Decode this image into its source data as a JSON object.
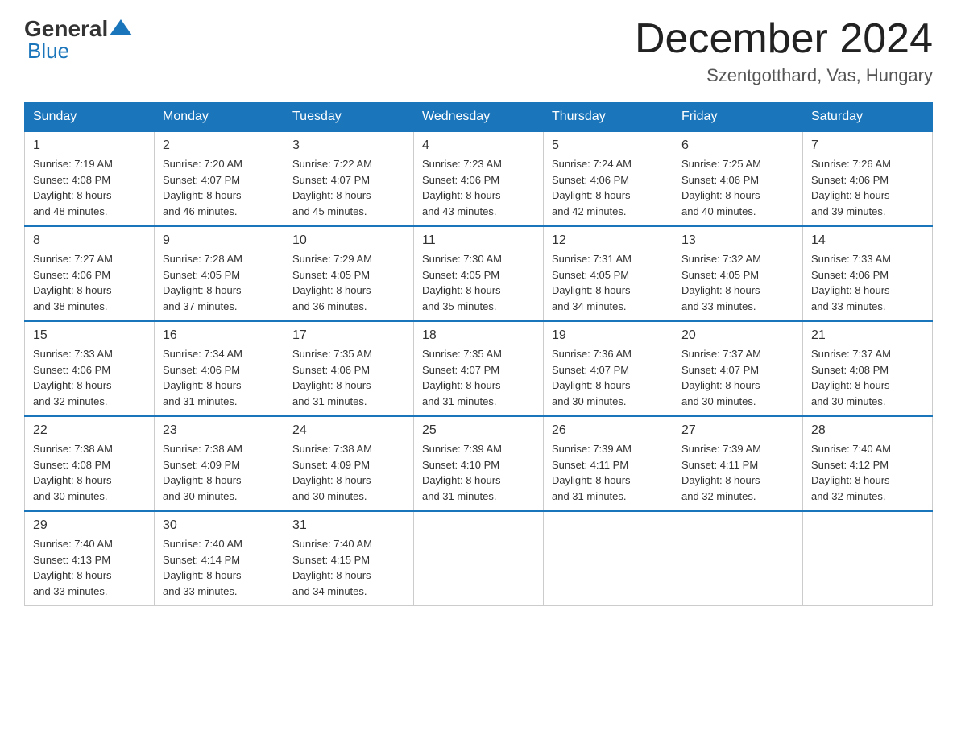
{
  "header": {
    "logo": {
      "general": "General",
      "blue": "Blue"
    },
    "title": "December 2024",
    "location": "Szentgotthard, Vas, Hungary"
  },
  "weekdays": [
    "Sunday",
    "Monday",
    "Tuesday",
    "Wednesday",
    "Thursday",
    "Friday",
    "Saturday"
  ],
  "weeks": [
    [
      {
        "day": "1",
        "sunrise": "7:19 AM",
        "sunset": "4:08 PM",
        "daylight": "8 hours and 48 minutes."
      },
      {
        "day": "2",
        "sunrise": "7:20 AM",
        "sunset": "4:07 PM",
        "daylight": "8 hours and 46 minutes."
      },
      {
        "day": "3",
        "sunrise": "7:22 AM",
        "sunset": "4:07 PM",
        "daylight": "8 hours and 45 minutes."
      },
      {
        "day": "4",
        "sunrise": "7:23 AM",
        "sunset": "4:06 PM",
        "daylight": "8 hours and 43 minutes."
      },
      {
        "day": "5",
        "sunrise": "7:24 AM",
        "sunset": "4:06 PM",
        "daylight": "8 hours and 42 minutes."
      },
      {
        "day": "6",
        "sunrise": "7:25 AM",
        "sunset": "4:06 PM",
        "daylight": "8 hours and 40 minutes."
      },
      {
        "day": "7",
        "sunrise": "7:26 AM",
        "sunset": "4:06 PM",
        "daylight": "8 hours and 39 minutes."
      }
    ],
    [
      {
        "day": "8",
        "sunrise": "7:27 AM",
        "sunset": "4:06 PM",
        "daylight": "8 hours and 38 minutes."
      },
      {
        "day": "9",
        "sunrise": "7:28 AM",
        "sunset": "4:05 PM",
        "daylight": "8 hours and 37 minutes."
      },
      {
        "day": "10",
        "sunrise": "7:29 AM",
        "sunset": "4:05 PM",
        "daylight": "8 hours and 36 minutes."
      },
      {
        "day": "11",
        "sunrise": "7:30 AM",
        "sunset": "4:05 PM",
        "daylight": "8 hours and 35 minutes."
      },
      {
        "day": "12",
        "sunrise": "7:31 AM",
        "sunset": "4:05 PM",
        "daylight": "8 hours and 34 minutes."
      },
      {
        "day": "13",
        "sunrise": "7:32 AM",
        "sunset": "4:05 PM",
        "daylight": "8 hours and 33 minutes."
      },
      {
        "day": "14",
        "sunrise": "7:33 AM",
        "sunset": "4:06 PM",
        "daylight": "8 hours and 33 minutes."
      }
    ],
    [
      {
        "day": "15",
        "sunrise": "7:33 AM",
        "sunset": "4:06 PM",
        "daylight": "8 hours and 32 minutes."
      },
      {
        "day": "16",
        "sunrise": "7:34 AM",
        "sunset": "4:06 PM",
        "daylight": "8 hours and 31 minutes."
      },
      {
        "day": "17",
        "sunrise": "7:35 AM",
        "sunset": "4:06 PM",
        "daylight": "8 hours and 31 minutes."
      },
      {
        "day": "18",
        "sunrise": "7:35 AM",
        "sunset": "4:07 PM",
        "daylight": "8 hours and 31 minutes."
      },
      {
        "day": "19",
        "sunrise": "7:36 AM",
        "sunset": "4:07 PM",
        "daylight": "8 hours and 30 minutes."
      },
      {
        "day": "20",
        "sunrise": "7:37 AM",
        "sunset": "4:07 PM",
        "daylight": "8 hours and 30 minutes."
      },
      {
        "day": "21",
        "sunrise": "7:37 AM",
        "sunset": "4:08 PM",
        "daylight": "8 hours and 30 minutes."
      }
    ],
    [
      {
        "day": "22",
        "sunrise": "7:38 AM",
        "sunset": "4:08 PM",
        "daylight": "8 hours and 30 minutes."
      },
      {
        "day": "23",
        "sunrise": "7:38 AM",
        "sunset": "4:09 PM",
        "daylight": "8 hours and 30 minutes."
      },
      {
        "day": "24",
        "sunrise": "7:38 AM",
        "sunset": "4:09 PM",
        "daylight": "8 hours and 30 minutes."
      },
      {
        "day": "25",
        "sunrise": "7:39 AM",
        "sunset": "4:10 PM",
        "daylight": "8 hours and 31 minutes."
      },
      {
        "day": "26",
        "sunrise": "7:39 AM",
        "sunset": "4:11 PM",
        "daylight": "8 hours and 31 minutes."
      },
      {
        "day": "27",
        "sunrise": "7:39 AM",
        "sunset": "4:11 PM",
        "daylight": "8 hours and 32 minutes."
      },
      {
        "day": "28",
        "sunrise": "7:40 AM",
        "sunset": "4:12 PM",
        "daylight": "8 hours and 32 minutes."
      }
    ],
    [
      {
        "day": "29",
        "sunrise": "7:40 AM",
        "sunset": "4:13 PM",
        "daylight": "8 hours and 33 minutes."
      },
      {
        "day": "30",
        "sunrise": "7:40 AM",
        "sunset": "4:14 PM",
        "daylight": "8 hours and 33 minutes."
      },
      {
        "day": "31",
        "sunrise": "7:40 AM",
        "sunset": "4:15 PM",
        "daylight": "8 hours and 34 minutes."
      },
      null,
      null,
      null,
      null
    ]
  ],
  "labels": {
    "sunrise": "Sunrise:",
    "sunset": "Sunset:",
    "daylight": "Daylight:"
  }
}
